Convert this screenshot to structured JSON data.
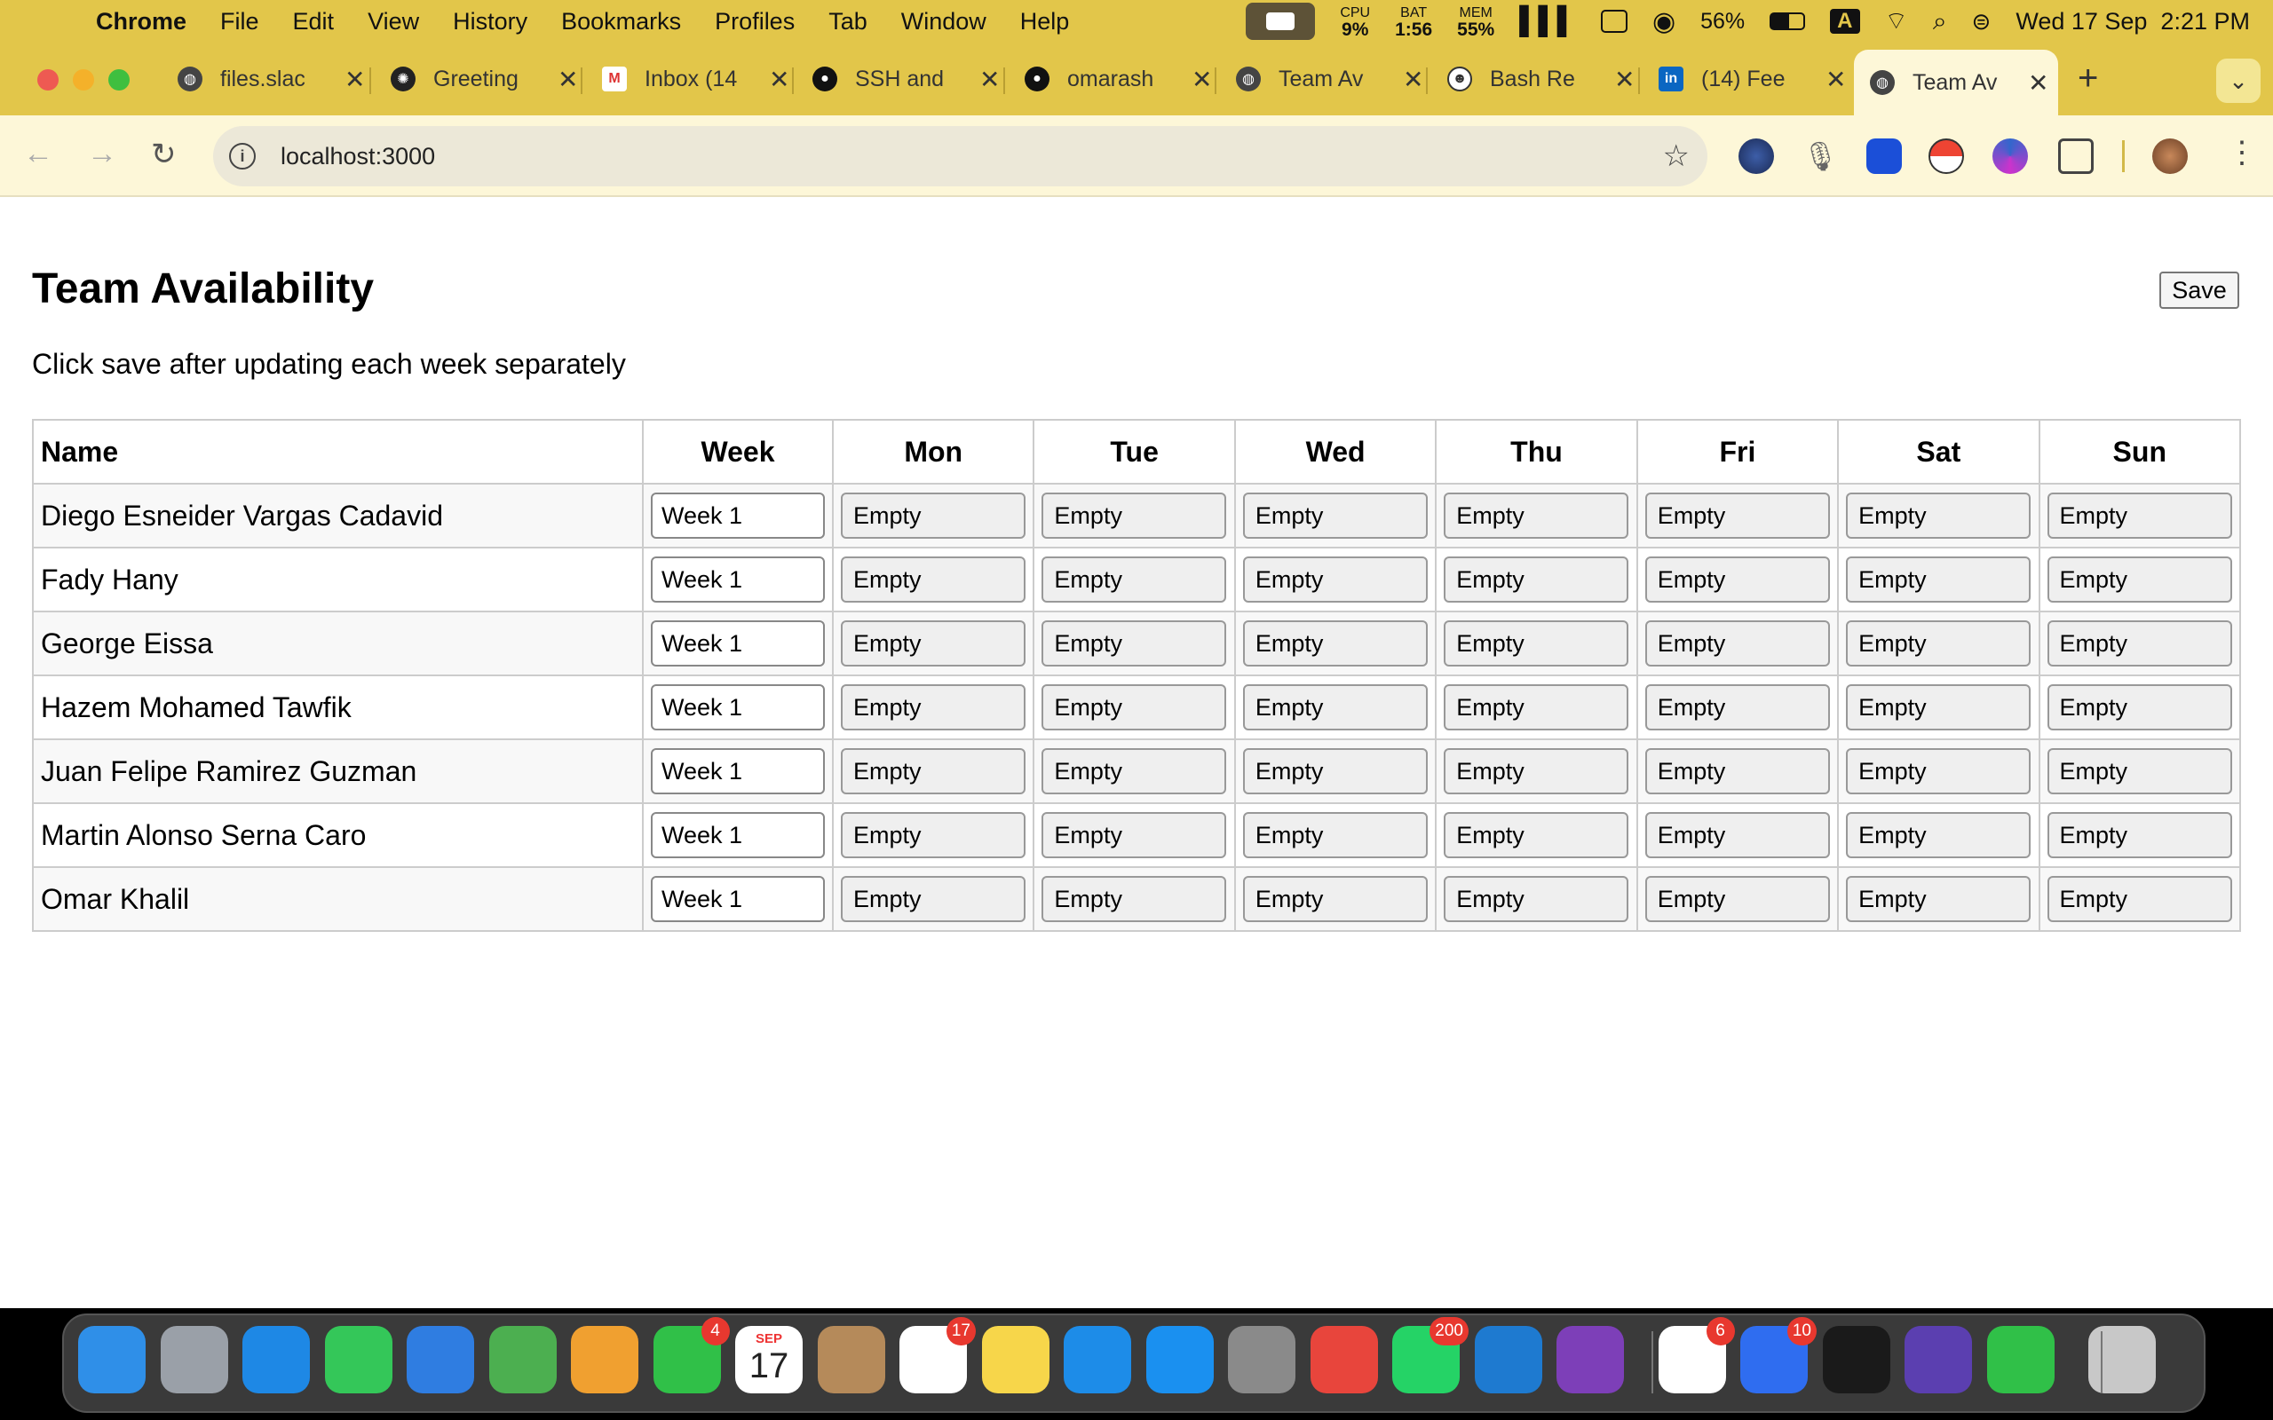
{
  "menubar": {
    "app_name": "Chrome",
    "menus": [
      "File",
      "Edit",
      "View",
      "History",
      "Bookmarks",
      "Profiles",
      "Tab",
      "Window",
      "Help"
    ],
    "cpu_label": "CPU",
    "cpu_value": "9%",
    "bat_label": "BAT",
    "bat_value": "1:56",
    "mem_label": "MEM",
    "mem_value": "55%",
    "battery_pct": "56%",
    "input_source": "A",
    "datetime": "Wed 17 Sep  2:21 PM"
  },
  "tabs": [
    {
      "title": "files.slac",
      "icon": "globe-icon"
    },
    {
      "title": "Greeting",
      "icon": "chatgpt-icon"
    },
    {
      "title": "Inbox (14",
      "icon": "gmail-icon"
    },
    {
      "title": "SSH and",
      "icon": "github-icon"
    },
    {
      "title": "omarash",
      "icon": "github-icon"
    },
    {
      "title": "Team Av",
      "icon": "globe-icon"
    },
    {
      "title": "Bash Re",
      "icon": "bash-icon"
    },
    {
      "title": "(14) Fee",
      "icon": "linkedin-icon"
    },
    {
      "title": "Team Av",
      "icon": "globe-icon",
      "active": true
    }
  ],
  "address_bar": {
    "url": "localhost:3000"
  },
  "page": {
    "title": "Team Availability",
    "save_label": "Save",
    "instructions": "Click save after updating each week separately",
    "columns": [
      "Name",
      "Week",
      "Mon",
      "Tue",
      "Wed",
      "Thu",
      "Fri",
      "Sat",
      "Sun"
    ],
    "rows": [
      {
        "name": "Diego Esneider Vargas Cadavid",
        "week": "Week 1",
        "days": [
          "Empty",
          "Empty",
          "Empty",
          "Empty",
          "Empty",
          "Empty",
          "Empty"
        ]
      },
      {
        "name": "Fady Hany",
        "week": "Week 1",
        "days": [
          "Empty",
          "Empty",
          "Empty",
          "Empty",
          "Empty",
          "Empty",
          "Empty"
        ]
      },
      {
        "name": "George Eissa",
        "week": "Week 1",
        "days": [
          "Empty",
          "Empty",
          "Empty",
          "Empty",
          "Empty",
          "Empty",
          "Empty"
        ]
      },
      {
        "name": "Hazem Mohamed Tawfik",
        "week": "Week 1",
        "days": [
          "Empty",
          "Empty",
          "Empty",
          "Empty",
          "Empty",
          "Empty",
          "Empty"
        ]
      },
      {
        "name": "Juan Felipe Ramirez Guzman",
        "week": "Week 1",
        "days": [
          "Empty",
          "Empty",
          "Empty",
          "Empty",
          "Empty",
          "Empty",
          "Empty"
        ]
      },
      {
        "name": "Martin Alonso Serna Caro",
        "week": "Week 1",
        "days": [
          "Empty",
          "Empty",
          "Empty",
          "Empty",
          "Empty",
          "Empty",
          "Empty"
        ]
      },
      {
        "name": "Omar Khalil",
        "week": "Week 1",
        "days": [
          "Empty",
          "Empty",
          "Empty",
          "Empty",
          "Empty",
          "Empty",
          "Empty"
        ]
      }
    ]
  },
  "dock": {
    "apps": [
      {
        "name": "finder",
        "color": "#2f8fe8"
      },
      {
        "name": "launchpad",
        "color": "#9aa0a8"
      },
      {
        "name": "safari",
        "color": "#1e88e5"
      },
      {
        "name": "messages",
        "color": "#34c759"
      },
      {
        "name": "mail",
        "color": "#2f7de1"
      },
      {
        "name": "maps",
        "color": "#4caf50"
      },
      {
        "name": "photos",
        "color": "#f0a030"
      },
      {
        "name": "facetime",
        "color": "#30c048",
        "badge": "4"
      },
      {
        "name": "calendar",
        "color": "#ffffff"
      },
      {
        "name": "contacts",
        "color": "#b58a5a"
      },
      {
        "name": "reminders",
        "color": "#ffffff",
        "badge": "17"
      },
      {
        "name": "notes",
        "color": "#f7d64a"
      },
      {
        "name": "docker",
        "color": "#1d8ce8"
      },
      {
        "name": "app-store",
        "color": "#1a90f0"
      },
      {
        "name": "system-settings",
        "color": "#8a8a8a"
      },
      {
        "name": "chrome",
        "color": "#e8453c"
      },
      {
        "name": "whatsapp",
        "color": "#25d366",
        "badge": "200"
      },
      {
        "name": "vscode",
        "color": "#1e7ad0"
      },
      {
        "name": "github-desktop",
        "color": "#7d3fb8"
      },
      {
        "name": "slack",
        "color": "#ffffff",
        "badge": "6"
      },
      {
        "name": "messenger",
        "color": "#2f6df0",
        "badge": "10"
      },
      {
        "name": "terminal",
        "color": "#1a1a1a"
      },
      {
        "name": "obsidian",
        "color": "#5b3fb0"
      },
      {
        "name": "facetime-2",
        "color": "#30c048"
      },
      {
        "name": "trash",
        "color": "#c8c8c8"
      }
    ],
    "calendar_month": "SEP",
    "calendar_day": "17"
  }
}
